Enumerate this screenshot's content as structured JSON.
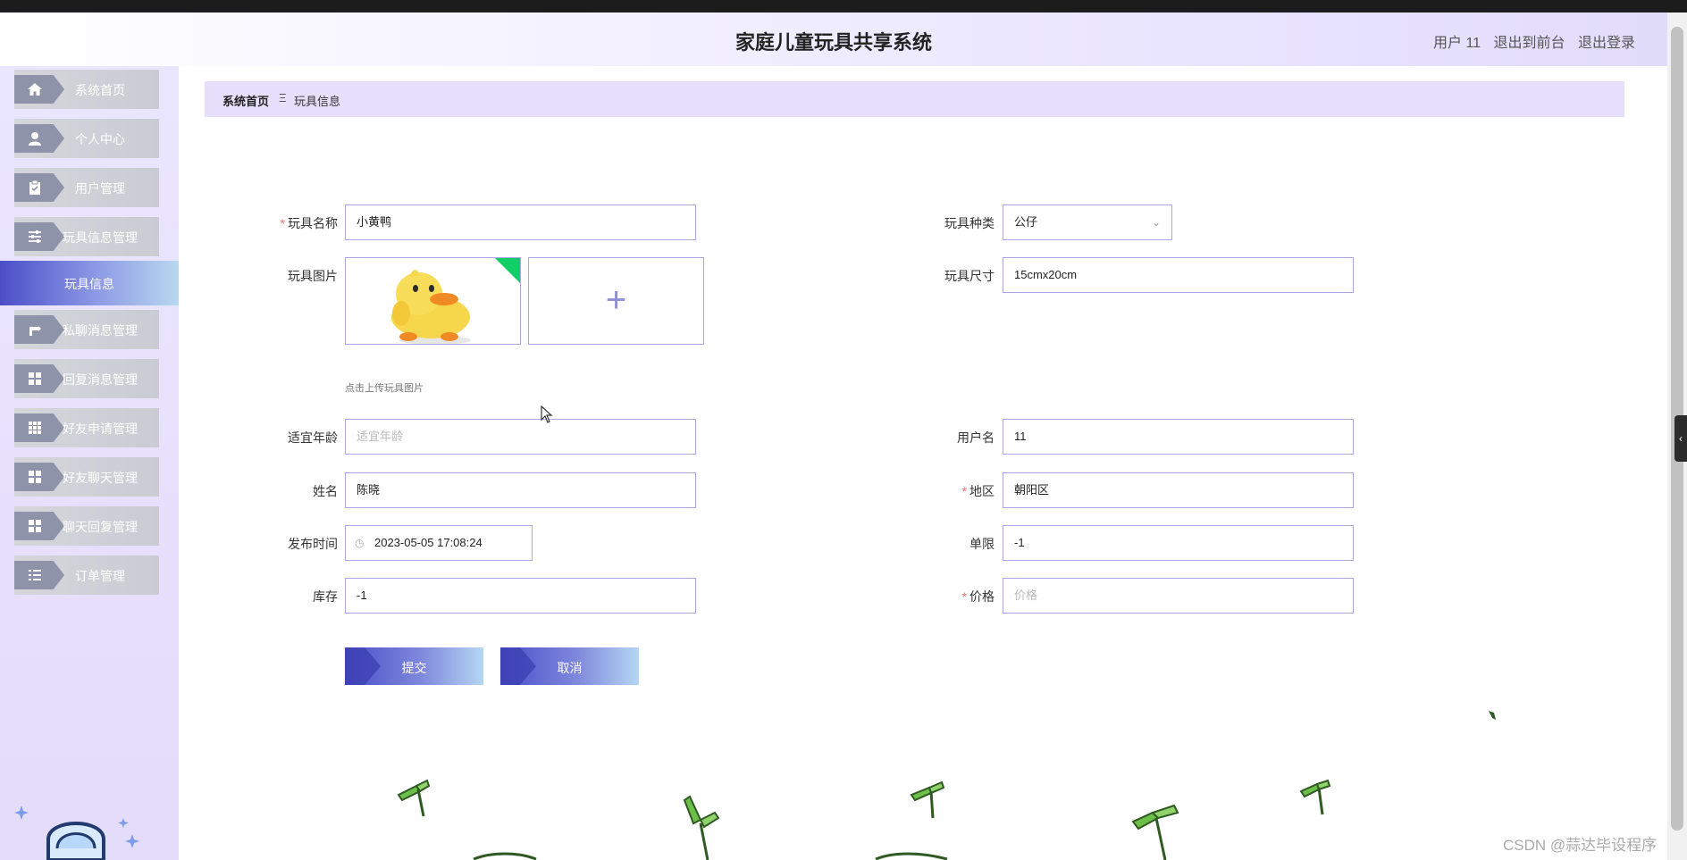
{
  "header": {
    "title": "家庭儿童玩具共享系统",
    "user_label": "用户 11",
    "to_front": "退出到前台",
    "logout": "退出登录"
  },
  "sidebar": {
    "items": [
      {
        "label": "系统首页",
        "icon": "home-icon"
      },
      {
        "label": "个人中心",
        "icon": "user-icon"
      },
      {
        "label": "用户管理",
        "icon": "clipboard-icon"
      },
      {
        "label": "玩具信息管理",
        "icon": "sliders-icon"
      },
      {
        "label": "玩具信息",
        "icon": "",
        "active": true
      },
      {
        "label": "私聊消息管理",
        "icon": "message-icon"
      },
      {
        "label": "回复消息管理",
        "icon": "grid-icon"
      },
      {
        "label": "好友申请管理",
        "icon": "grid-icon"
      },
      {
        "label": "好友聊天管理",
        "icon": "grid-icon"
      },
      {
        "label": "聊天回复管理",
        "icon": "grid-icon"
      },
      {
        "label": "订单管理",
        "icon": "list-icon"
      }
    ]
  },
  "breadcrumb": {
    "home": "系统首页",
    "separator": "Ξ",
    "current": "玩具信息"
  },
  "form": {
    "toy_name": {
      "label": "玩具名称",
      "value": "小黄鸭",
      "required": true
    },
    "toy_type": {
      "label": "玩具种类",
      "value": "公仔"
    },
    "toy_image": {
      "label": "玩具图片",
      "tip": "点击上传玩具图片"
    },
    "toy_size": {
      "label": "玩具尺寸",
      "value": "15cmx20cm"
    },
    "age": {
      "label": "适宜年龄",
      "placeholder": "适宜年龄"
    },
    "username": {
      "label": "用户名",
      "value": "11"
    },
    "name": {
      "label": "姓名",
      "value": "陈晓"
    },
    "region": {
      "label": "地区",
      "value": "朝阳区",
      "required": true
    },
    "publish_time": {
      "label": "发布时间",
      "value": "2023-05-05 17:08:24"
    },
    "limit": {
      "label": "单限",
      "value": "-1"
    },
    "stock": {
      "label": "库存",
      "value": "-1"
    },
    "price": {
      "label": "价格",
      "placeholder": "价格",
      "required": true
    },
    "submit": "提交",
    "cancel": "取消"
  },
  "watermark": "CSDN @蒜达毕设程序",
  "colors": {
    "accent": "#4b4ec8",
    "input_border": "#aaa6e6",
    "breadcrumb_bg": "#e6e0fc",
    "sidebar_bg": "#ebe6ff",
    "required": "#f56c6c",
    "success_corner": "#13ce66"
  }
}
